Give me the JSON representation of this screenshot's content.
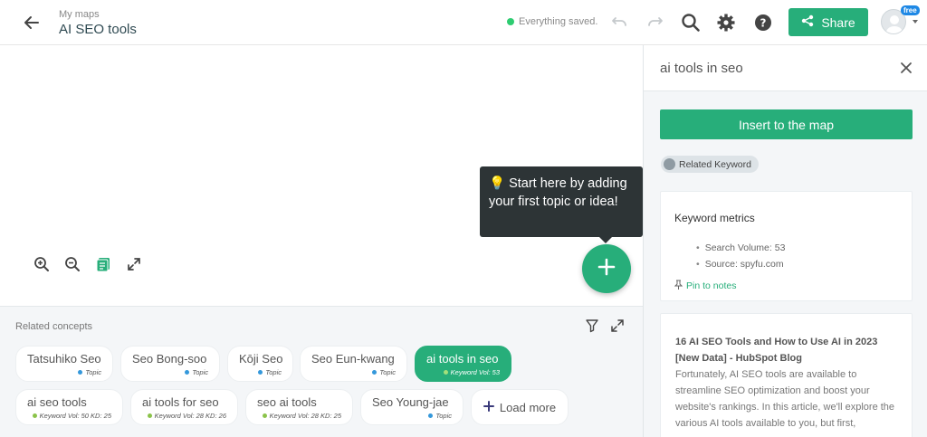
{
  "header": {
    "breadcrumb": "My maps",
    "map_title": "AI SEO tools",
    "save_status": "Everything saved.",
    "share_label": "Share",
    "plan_badge": "free",
    "icons": [
      "arrow-left-icon",
      "undo-icon",
      "redo-icon",
      "search-icon",
      "gear-icon",
      "help-icon",
      "share-icon",
      "avatar-icon"
    ],
    "colors": {
      "accent": "#27ae7a",
      "saved_dot": "#2ecc71",
      "badge": "#1e88e5"
    }
  },
  "canvas": {
    "tooltip": "💡 Start here by adding your first topic or idea!",
    "tools": [
      "zoom-in-icon",
      "zoom-out-icon",
      "notes-icon",
      "fullscreen-icon"
    ]
  },
  "related": {
    "title": "Related concepts",
    "load_more": "Load more",
    "chips": [
      {
        "name": "Tatsuhiko Seo",
        "meta": "Topic",
        "dot": "#3498db"
      },
      {
        "name": "Seo Bong-soo",
        "meta": "Topic",
        "dot": "#3498db"
      },
      {
        "name": "Kōji Seo",
        "meta": "Topic",
        "dot": "#3498db"
      },
      {
        "name": "Seo Eun-kwang",
        "meta": "Topic",
        "dot": "#3498db"
      },
      {
        "name": "ai tools in seo",
        "meta": "Keyword Vol: 53",
        "dot": "#a3e07b"
      },
      {
        "name": "ai seo tools",
        "meta": "Keyword Vol: 50 KD: 25",
        "dot": "#8bc34a"
      },
      {
        "name": "ai tools for seo",
        "meta": "Keyword Vol: 28 KD: 26",
        "dot": "#8bc34a"
      },
      {
        "name": "seo ai tools",
        "meta": "Keyword Vol: 28 KD: 25",
        "dot": "#8bc34a"
      },
      {
        "name": "Seo Young-jae",
        "meta": "Topic",
        "dot": "#3498db"
      }
    ]
  },
  "panel": {
    "title": "ai tools in seo",
    "insert_label": "Insert to the map",
    "badge": "Related Keyword",
    "metrics_title": "Keyword metrics",
    "metrics": [
      "Search Volume: 53",
      "Source: spyfu.com"
    ],
    "pin_label": "Pin to notes",
    "article_title": "16 AI SEO Tools and How to Use AI in 2023 [New Data] - HubSpot Blog",
    "article_body": "Fortunately, AI SEO tools are available to streamline SEO optimization and boost your website's rankings. In this article, we'll explore the various AI tools available to you, but first,"
  }
}
